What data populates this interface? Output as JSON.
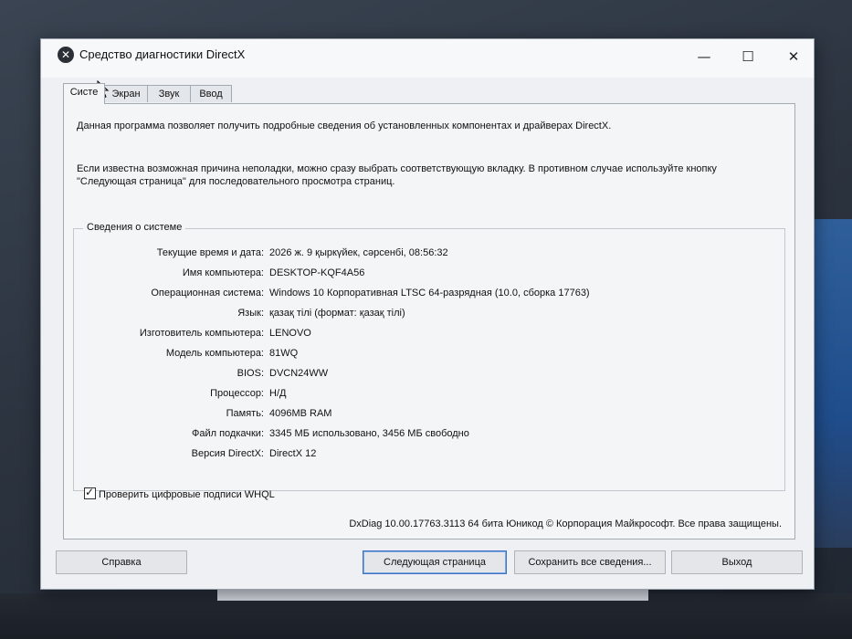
{
  "window": {
    "title": "Средство диагностики DirectX",
    "controls": {
      "minimize": "—",
      "maximize": "☐",
      "close": "✕"
    }
  },
  "tabs": [
    {
      "label": "Систе",
      "active": true
    },
    {
      "label": "Экран",
      "active": false
    },
    {
      "label": "Звук",
      "active": false
    },
    {
      "label": "Ввод",
      "active": false
    }
  ],
  "intro": {
    "line1": "Данная программа позволяет получить подробные сведения об установленных компонентах и драйверах DirectX.",
    "line2": "Если известна возможная причина неполадки, можно сразу выбрать соответствующую вкладку. В противном случае используйте кнопку \"Следующая страница\" для последовательного просмотра страниц."
  },
  "system_info": {
    "title": "Сведения о системе",
    "rows": [
      {
        "label": "Текущие время и дата:",
        "value": "2026 ж. 9 қыркүйек, сәрсенбі, 08:56:32"
      },
      {
        "label": "Имя компьютера:",
        "value": "DESKTOP-KQF4A56"
      },
      {
        "label": "Операционная система:",
        "value": "Windows 10 Корпоративная LTSC 64-разрядная (10.0, сборка 17763)"
      },
      {
        "label": "Язык:",
        "value": "қазақ тілі (формат: қазақ тілі)"
      },
      {
        "label": "Изготовитель компьютера:",
        "value": "LENOVO"
      },
      {
        "label": "Модель компьютера:",
        "value": "81WQ"
      },
      {
        "label": "BIOS:",
        "value": "DVCN24WW"
      },
      {
        "label": "Процессор:",
        "value": "Н/Д"
      },
      {
        "label": "Память:",
        "value": "4096MB RAM"
      },
      {
        "label": "Файл подкачки:",
        "value": "3345 МБ использовано, 3456 МБ свободно"
      },
      {
        "label": "Версия DirectX:",
        "value": "DirectX 12"
      }
    ]
  },
  "whql": {
    "label": "Проверить цифровые подписи WHQL",
    "checked": true,
    "mark": "✓"
  },
  "copyright": "DxDiag 10.00.17763.3113 64 бита Юникод © Корпорация Майкрософт. Все права защищены.",
  "buttons": {
    "help": "Справка",
    "next": "Следующая страница",
    "save": "Сохранить все сведения...",
    "exit": "Выход"
  },
  "icons": {
    "app": "dxdiag-icon",
    "cursor": "mouse-pointer-icon"
  },
  "colors": {
    "accent": "#3a72c4",
    "window_bg": "#eef0f3"
  }
}
